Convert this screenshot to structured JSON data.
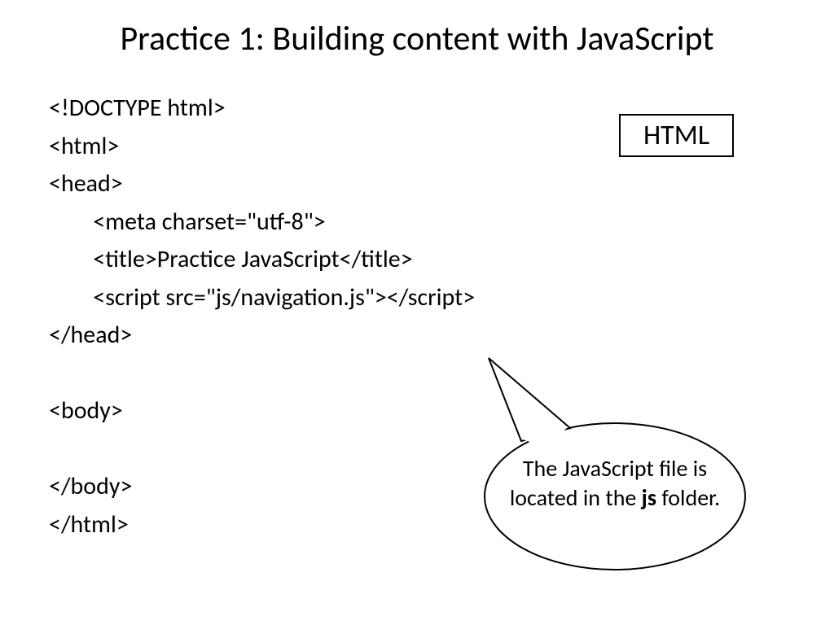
{
  "title": "Practice 1: Building content with JavaScript",
  "label": "HTML",
  "code": {
    "l1": "<!DOCTYPE html>",
    "l2": "<html>",
    "l3": "<head>",
    "l4": "        <meta charset=\"utf-8\">",
    "l5": "        <title>Practice JavaScript</title>",
    "l6": "        <script src=\"js/navigation.js\"></scr",
    "l6b": "ipt>",
    "l7": "</head>",
    "l8": "",
    "l9": "<body>",
    "l10": "",
    "l11": "</body>",
    "l12": "</html>"
  },
  "callout": {
    "part1": "The JavaScript file is located in the ",
    "bold": "js",
    "part2": " folder."
  }
}
